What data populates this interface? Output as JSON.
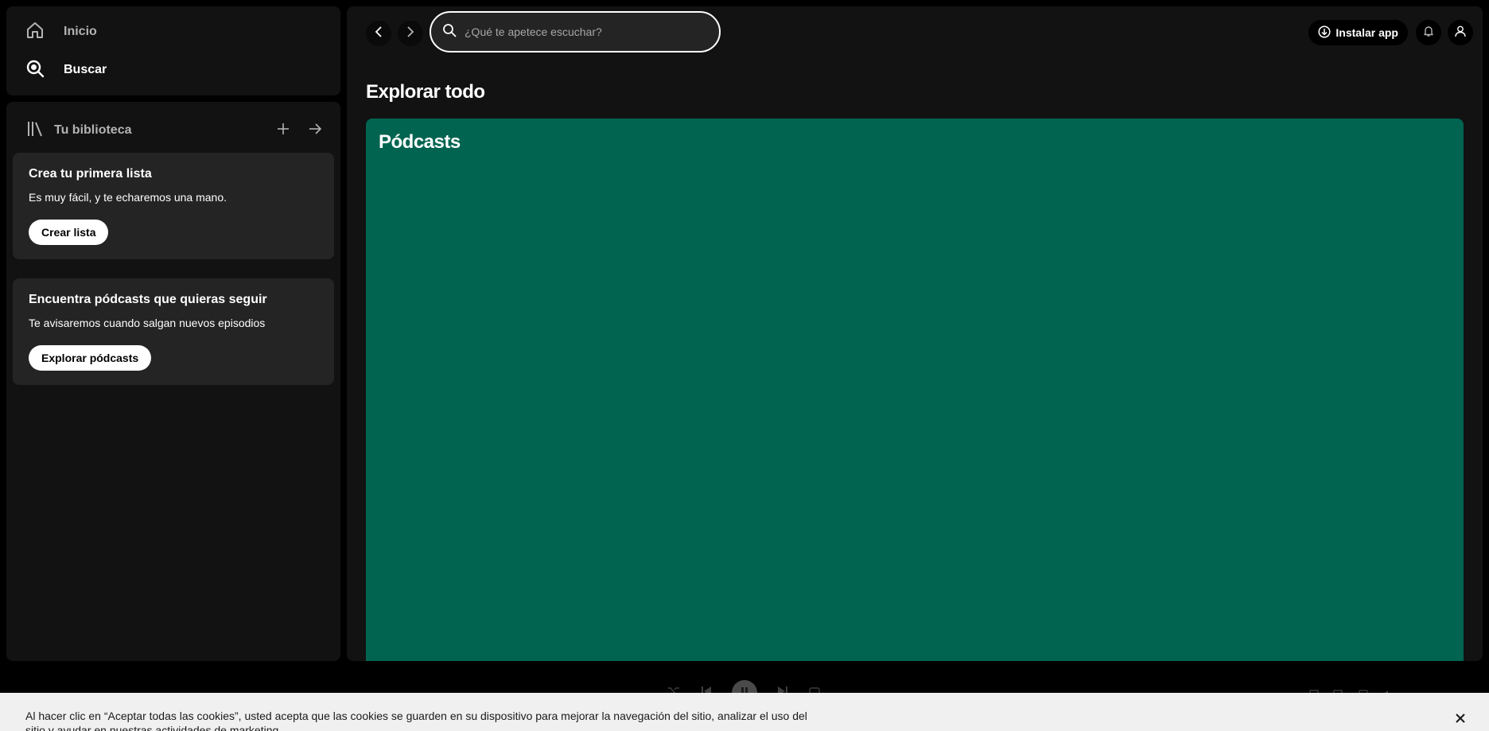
{
  "sidebar": {
    "nav": {
      "home_label": "Inicio",
      "search_label": "Buscar"
    },
    "library": {
      "title": "Tu biblioteca",
      "cards": [
        {
          "title": "Crea tu primera lista",
          "text": "Es muy fácil, y te echaremos una mano.",
          "button": "Crear lista"
        },
        {
          "title": "Encuentra pódcasts que quieras seguir",
          "text": "Te avisaremos cuando salgan nuevos episodios",
          "button": "Explorar pódcasts"
        }
      ]
    }
  },
  "header": {
    "search_placeholder": "¿Qué te apetece escuchar?",
    "install_label": "Instalar app"
  },
  "main": {
    "section_title": "Explorar todo",
    "categories": [
      {
        "title": "Pódcasts",
        "color": "#006450"
      }
    ]
  },
  "cookie_banner": {
    "text": "Al hacer clic en “Aceptar todas las cookies”, usted acepta que las cookies se guarden en su dispositivo para mejorar la navegación del sitio, analizar el uso del sitio y ayudar en nuestras actividades de marketing."
  },
  "colors": {
    "background": "#000000",
    "panel": "#121212",
    "card": "#242424",
    "podcasts_card": "#006450",
    "banner": "#f0f0f0"
  }
}
